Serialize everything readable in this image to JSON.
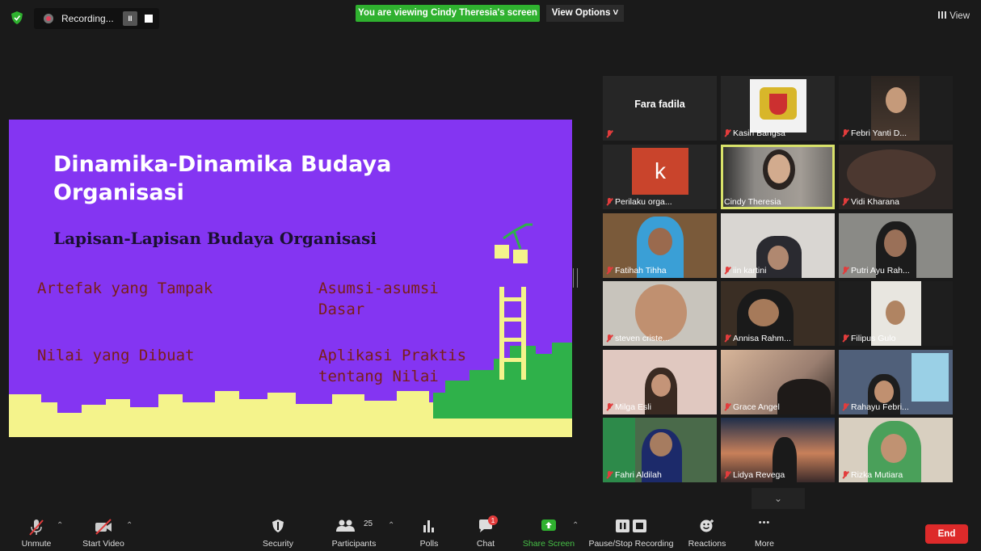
{
  "recording": {
    "label": "Recording...",
    "pause_glyph": "II"
  },
  "banner": {
    "viewing": "You are viewing Cindy Theresia's screen",
    "view_options": "View Options ˅"
  },
  "view_button": "View",
  "slide": {
    "title_line1": "Dinamika-Dinamika Budaya",
    "title_line2": "Organisasi",
    "subtitle": "Lapisan-Lapisan Budaya Organisasi",
    "item1": "Artefak yang Tampak",
    "item2_line1": "Asumsi-asumsi",
    "item2_line2": "Dasar",
    "item3": "Nilai yang Dibuat",
    "item4_line1": "Aplikasi Praktis",
    "item4_line2": "tentang Nilai",
    "colors": {
      "background": "#8435f2",
      "ground": "#f4f38b",
      "grass": "#2fb14a",
      "text": "#7a1e16"
    }
  },
  "participants": [
    {
      "name": "",
      "big_label": "Fara fadila"
    },
    {
      "name": "Kasih Bangsa"
    },
    {
      "name": "Febri Yanti D..."
    },
    {
      "name": "Perilaku orga...",
      "avatar_letter": "k"
    },
    {
      "name": "Cindy Theresia"
    },
    {
      "name": "Vidi Kharana"
    },
    {
      "name": "Fatihah Tihha"
    },
    {
      "name": "iin kartini"
    },
    {
      "name": "Putri Ayu Rah..."
    },
    {
      "name": "steven criste..."
    },
    {
      "name": "Annisa Rahm..."
    },
    {
      "name": "Filipus Gulo"
    },
    {
      "name": "Milga Esli"
    },
    {
      "name": "Grace Angel"
    },
    {
      "name": "Rahayu Febri..."
    },
    {
      "name": "Fahri Aldilah"
    },
    {
      "name": "Lidya Revega"
    },
    {
      "name": "Rizka Mutiara"
    }
  ],
  "toolbar": {
    "unmute": "Unmute",
    "start_video": "Start Video",
    "security": "Security",
    "participants": "Participants",
    "participant_count": "25",
    "polls": "Polls",
    "chat": "Chat",
    "chat_badge": "1",
    "share_screen": "Share Screen",
    "pause_stop_recording": "Pause/Stop Recording",
    "reactions": "Reactions",
    "more": "More",
    "more_glyph": "•••",
    "end": "End"
  }
}
